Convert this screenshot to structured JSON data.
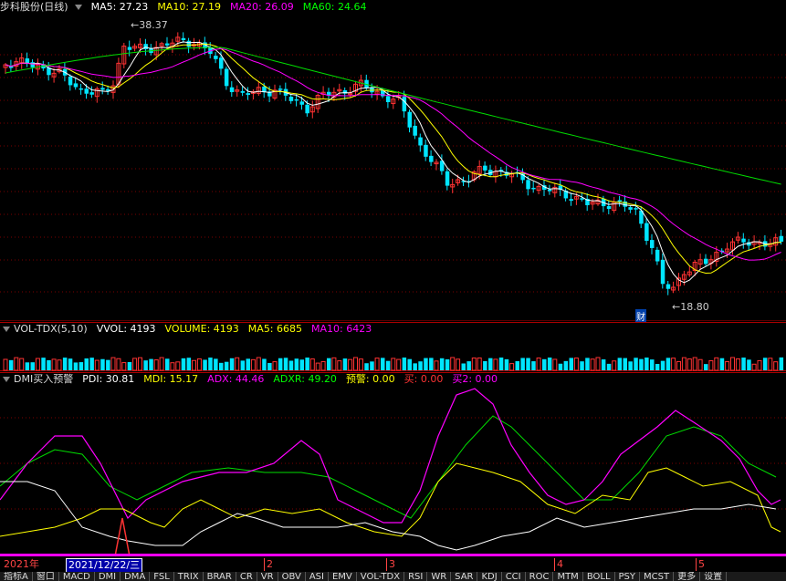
{
  "price_panel": {
    "title": "步科股份(日线)",
    "ma_labels": [
      {
        "text": "MA5: 27.23",
        "color": "#ffffff"
      },
      {
        "text": "MA10: 27.19",
        "color": "#ffff00"
      },
      {
        "text": "MA20: 26.09",
        "color": "#ff00ff"
      },
      {
        "text": "MA60: 24.64",
        "color": "#00ff00"
      }
    ],
    "high_label": "38.37",
    "low_label": "18.80",
    "finance_marker": "财"
  },
  "volume_panel": {
    "title": "VOL-TDX(5,10)",
    "labels": [
      {
        "text": "VVOL: 4193",
        "color": "#ffffff"
      },
      {
        "text": "VOLUME: 4193",
        "color": "#ffff00"
      },
      {
        "text": "MA5: 6685",
        "color": "#ffff00"
      },
      {
        "text": "MA10: 6423",
        "color": "#ff00ff"
      }
    ]
  },
  "dmi_panel": {
    "title": "DMI买入预警",
    "labels": [
      {
        "text": "PDI: 30.81",
        "color": "#ffffff"
      },
      {
        "text": "MDI: 15.17",
        "color": "#ffff00"
      },
      {
        "text": "ADX: 44.46",
        "color": "#ff00ff"
      },
      {
        "text": "ADXR: 49.20",
        "color": "#00ff00"
      },
      {
        "text": "预警: 0.00",
        "color": "#ffff00"
      },
      {
        "text": "买: 0.00",
        "color": "#ff3333"
      },
      {
        "text": "买2: 0.00",
        "color": "#ff00ff"
      }
    ]
  },
  "timeline": {
    "year_label": "2021年",
    "cursor_date": "2021/12/22/三",
    "months": [
      "2",
      "3",
      "4",
      "5"
    ]
  },
  "tabs": [
    "指标A",
    "窗口",
    "MACD",
    "DMI",
    "DMA",
    "FSL",
    "TRIX",
    "BRAR",
    "CR",
    "VR",
    "OBV",
    "ASI",
    "EMV",
    "VOL-TDX",
    "RSI",
    "WR",
    "SAR",
    "KDJ",
    "CCI",
    "ROC",
    "MTM",
    "BOLL",
    "PSY",
    "MCST",
    "更多",
    "设置"
  ],
  "chart_data": [
    {
      "type": "candlestick",
      "title": "步科股份(日线)",
      "series": [
        {
          "name": "MA5",
          "color": "#ffffff"
        },
        {
          "name": "MA10",
          "color": "#ffff00"
        },
        {
          "name": "MA20",
          "color": "#ff00ff"
        },
        {
          "name": "MA60",
          "color": "#00ff00"
        }
      ],
      "annotations": [
        "38.37",
        "18.80",
        "财"
      ],
      "grid": true,
      "up_color": "#ff3333",
      "down_color": "#00e5ff"
    },
    {
      "type": "bar",
      "title": "VOL-TDX(5,10)",
      "values_latest": {
        "VOLUME": 4193,
        "MA5": 6685,
        "MA10": 6423
      }
    },
    {
      "type": "line",
      "title": "DMI买入预警",
      "series": [
        {
          "name": "PDI",
          "latest": 30.81,
          "color": "#ffffff"
        },
        {
          "name": "MDI",
          "latest": 15.17,
          "color": "#ffff00"
        },
        {
          "name": "ADX",
          "latest": 44.46,
          "color": "#ff00ff"
        },
        {
          "name": "ADXR",
          "latest": 49.2,
          "color": "#00ff00"
        }
      ]
    }
  ]
}
